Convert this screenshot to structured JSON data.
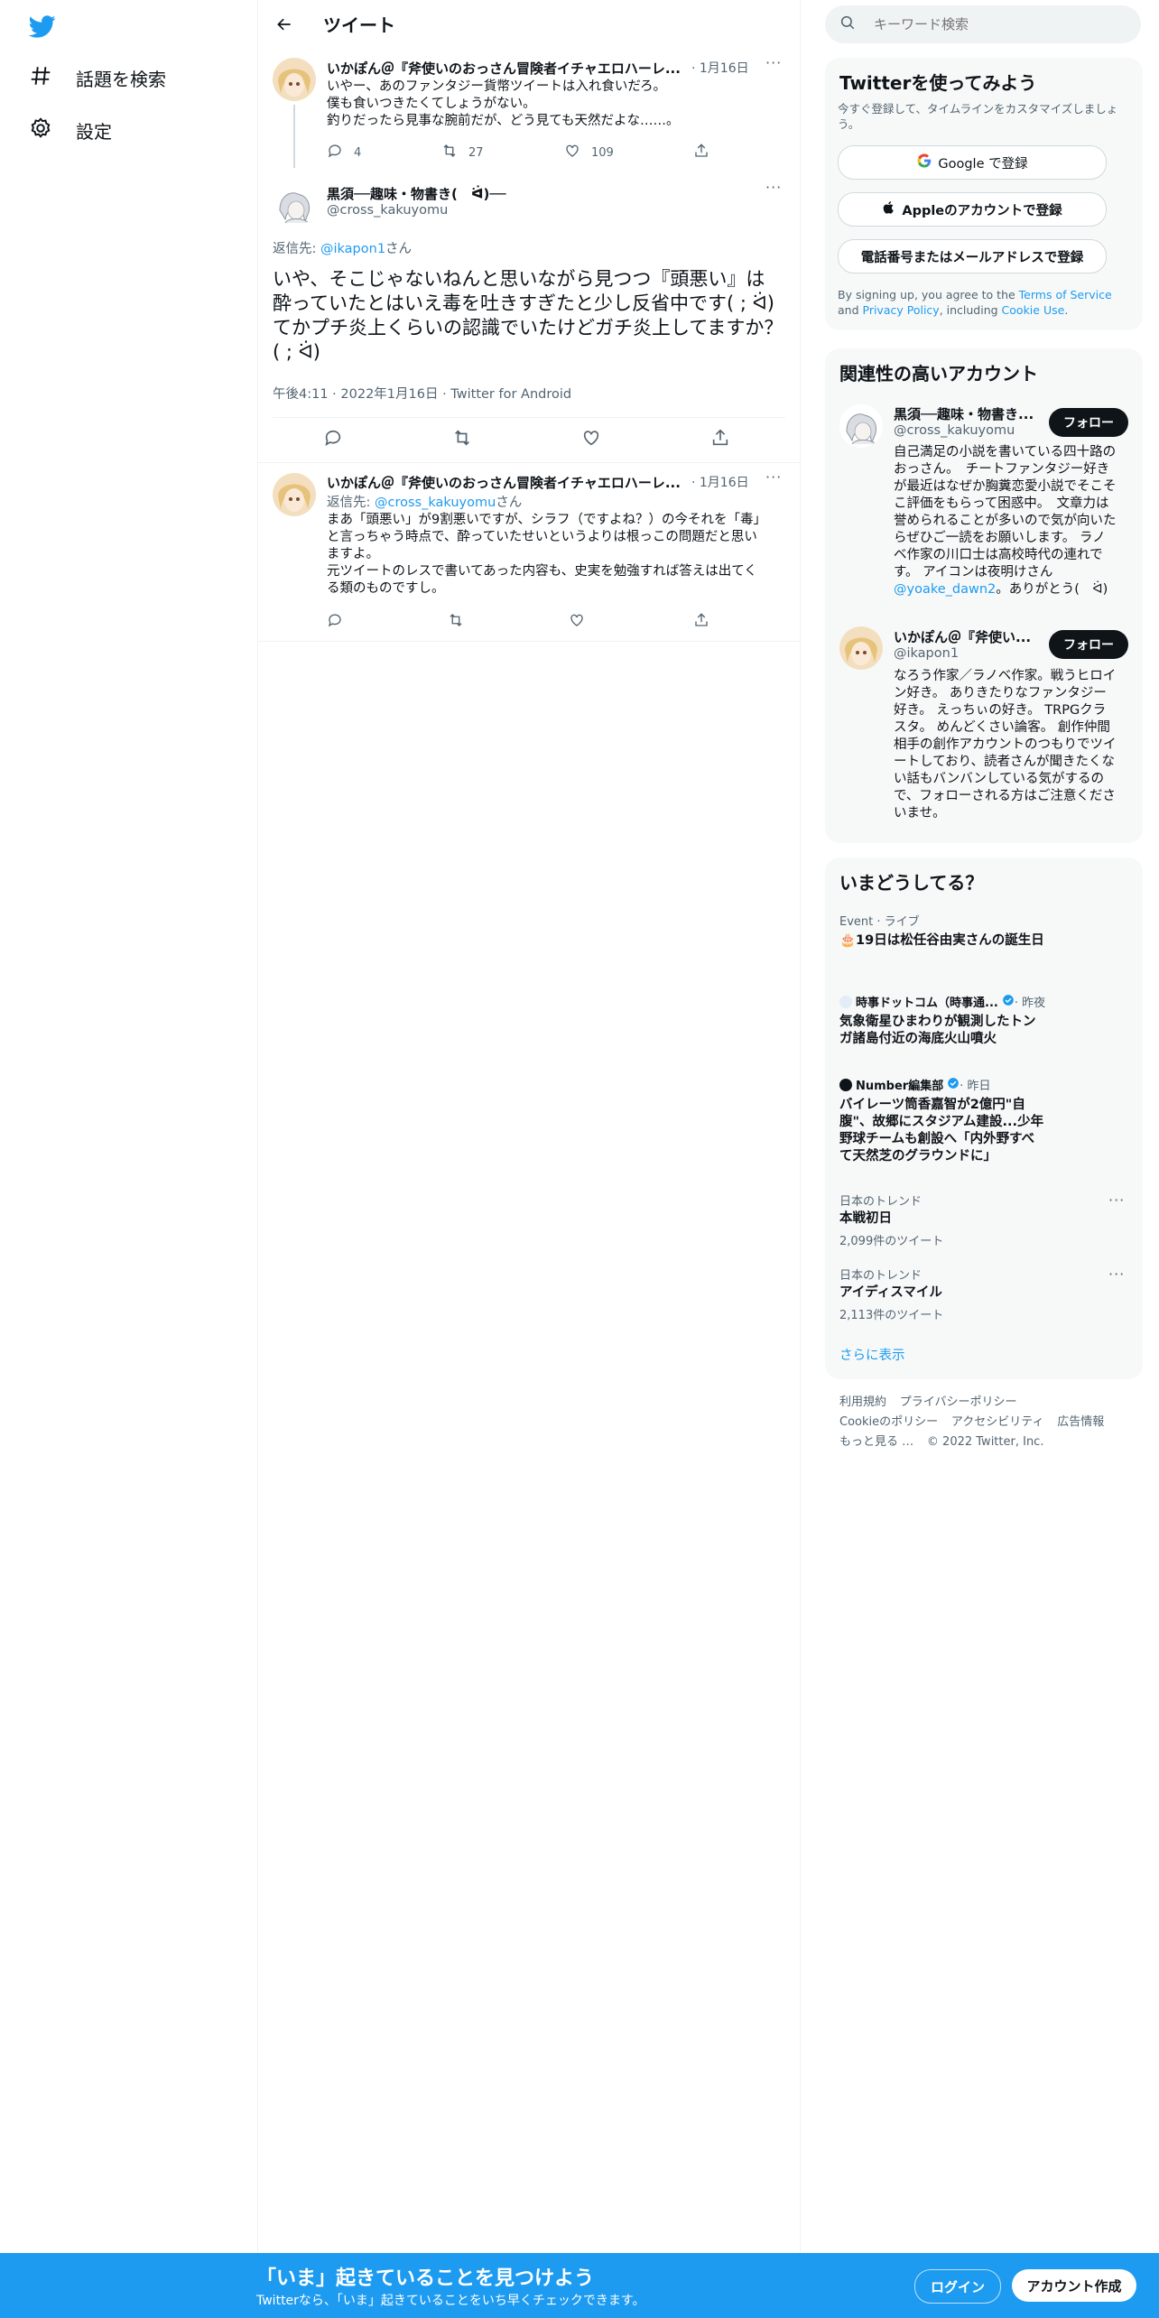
{
  "nav": {
    "logo": "twitter-bird-icon",
    "items": [
      {
        "label": "話題を検索",
        "icon": "hashtag-icon"
      },
      {
        "label": "設定",
        "icon": "gear-icon"
      }
    ]
  },
  "header": {
    "title": "ツイート"
  },
  "tweets": {
    "parent": {
      "name": "いかぽん＠『斧使いのおっさん冒険者イチャエロハーレ...",
      "date": "· 1月16日",
      "lines": [
        "いやー、あのファンタジー貨幣ツイートは入れ食いだろ。",
        "僕も食いつきたくてしょうがない。",
        "釣りだったら見事な腕前だが、どう見ても天然だよな……。"
      ],
      "reply_count": "4",
      "retweet_count": "27",
      "like_count": "109"
    },
    "main": {
      "name": "黒須──趣味・物書き(　ᐛ)──",
      "handle": "@cross_kakuyomu",
      "reply_prefix": "返信先: ",
      "reply_to": "@ikapon1",
      "reply_suffix": "さん",
      "text": "いや、そこじゃないねんと思いながら見つつ『頭悪い』は酔っていたとはいえ毒を吐きすぎたと少し反省中です( ; ᐛ)　てかプチ炎上くらいの認識でいたけどガチ炎上してますか？( ; ᐛ)",
      "meta": "午後4:11 · 2022年1月16日 · Twitter for Android"
    },
    "reply": {
      "name": "いかぽん＠『斧使いのおっさん冒険者イチャエロハーレ...",
      "date": "· 1月16日",
      "reply_prefix": "返信先: ",
      "reply_to": "@cross_kakuyomu",
      "reply_suffix": "さん",
      "lines": [
        "まあ「頭悪い」が9割悪いですが、シラフ（ですよね？）の今それを「毒」",
        "と言っちゃう時点で、酔っていたせいというよりは根っこの問題だと思い",
        "ますよ。",
        "元ツイートのレスで書いてあった内容も、史実を勉強すれば答えは出てく",
        "る類のものですし。"
      ]
    }
  },
  "search": {
    "placeholder": "キーワード検索"
  },
  "signup": {
    "title": "Twitterを使ってみよう",
    "subtitle": [
      "今すぐ登録して、タイムラインをカスタマイズしましょ",
      "う。"
    ],
    "google": "Google で登録",
    "apple": "Appleのアカウントで登録",
    "phone": "電話番号またはメールアドレスで登録",
    "legal_1": "By signing up, you agree to the ",
    "terms": "Terms of Service",
    "legal_2": " and ",
    "privacy": "Privacy Policy",
    "legal_3": ", including ",
    "cookie": "Cookie Use",
    "legal_4": "."
  },
  "related": {
    "title": "関連性の高いアカウント",
    "accounts": [
      {
        "name": "黒須──趣味・物書き...",
        "handle": "@cross_kakuyomu",
        "follow": "フォロー",
        "bio": [
          "自己満足の小説を書いている四十路の",
          "おっさん。　チートファンタジー好き",
          "が最近はなぜか胸糞恋愛小説でそこそ",
          "こ評価をもらって困惑中。　文章力は",
          "誉められることが多いので気が向いた",
          "らぜひご一読をお願いします。 ラノ",
          "ベ作家の川口士は高校時代の連れで",
          "す。 アイコンは夜明けさん"
        ],
        "bio_link": "@yoake_dawn2",
        "bio_tail": "。ありがとう(　ᐛ)"
      },
      {
        "name": "いかぽん＠『斧使い...",
        "handle": "@ikapon1",
        "follow": "フォロー",
        "bio": [
          "なろう作家／ラノベ作家。戦うヒロイ",
          "ン好き。 ありきたりなファンタジー",
          "好き。 えっちぃの好き。 TRPGクラ",
          "スタ。 めんどくさい論客。 創作仲間",
          "相手の創作アカウントのつもりでツイ",
          "ートしており、読者さんが聞きたくな",
          "い話もバンバンしている気がするの",
          "で、フォローされる方はご注意くださ",
          "いませ。"
        ]
      }
    ]
  },
  "trends": {
    "title": "いまどうしてる？",
    "items": [
      {
        "meta": "Event · ライブ",
        "title": "🎂19日は松任谷由実さんの誕生日"
      },
      {
        "source": "時事ドットコム（時事通...",
        "meta": " · 昨夜",
        "lines": [
          "気象衛星ひまわりが観測したトン",
          "ガ諸島付近の海底火山噴火"
        ]
      },
      {
        "source": "Number編集部",
        "meta": " · 昨日",
        "lines": [
          "バイレーツ筒香嘉智が2億円\"自",
          "腹\"、故郷にスタジアム建設...少年",
          "野球チームも創設へ「内外野すべ",
          "て天然芝のグラウンドに」"
        ]
      },
      {
        "meta": "日本のトレンド",
        "title": "本戦初日",
        "count": "2,099件のツイート"
      },
      {
        "meta": "日本のトレンド",
        "title": "アイディスマイル",
        "count": "2,113件のツイート"
      }
    ],
    "show_more": "さらに表示"
  },
  "footer": {
    "links": [
      "利用規約",
      "プライバシーポリシー",
      "Cookieのポリシー",
      "アクセシビリティ",
      "広告情報",
      "もっと見る …"
    ],
    "copyright": "© 2022 Twitter, Inc."
  },
  "bottom_bar": {
    "title": "「いま」起きていることを見つけよう",
    "subtitle": "Twitterなら、「いま」起きていることをいち早くチェックできます。",
    "login": "ログイン",
    "signup": "アカウント作成"
  },
  "colors": {
    "accent": "#1d9bf0",
    "text": "#0f1419",
    "muted": "#536471",
    "border": "#eff3f4",
    "card": "#f7f9f9"
  }
}
